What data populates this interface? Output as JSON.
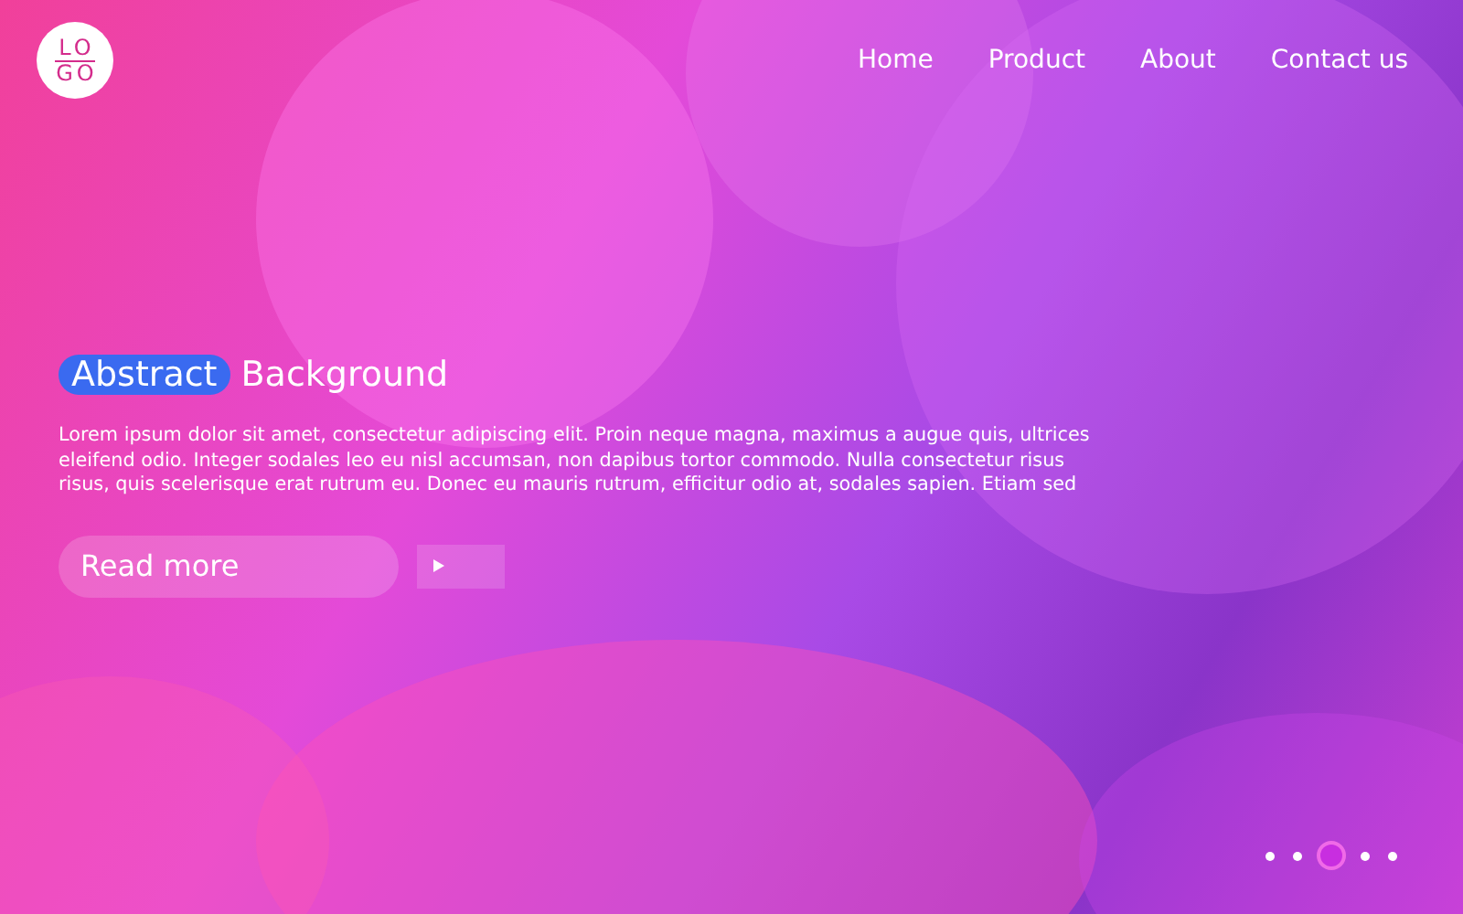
{
  "logo": {
    "lines": [
      "LO",
      "GO"
    ]
  },
  "nav": [
    {
      "label": "Home"
    },
    {
      "label": "Product"
    },
    {
      "label": "About"
    },
    {
      "label": "Contact us"
    }
  ],
  "hero": {
    "title_highlight": "Abstract",
    "title": "Background",
    "body": "Lorem ipsum dolor sit amet, consectetur adipiscing elit. Proin neque magna, maximus a augue quis, ultrices eleifend odio. Integer sodales leo eu nisl accumsan, non dapibus tortor commodo. Nulla consectetur risus risus, quis scelerisque erat rutrum eu. Donec eu mauris rutrum, efficitur odio at, sodales sapien. Etiam sed",
    "button": "Read more"
  },
  "pager": [
    {
      "selected": false
    },
    {
      "selected": false
    },
    {
      "selected": true
    },
    {
      "selected": false
    },
    {
      "selected": false
    }
  ]
}
